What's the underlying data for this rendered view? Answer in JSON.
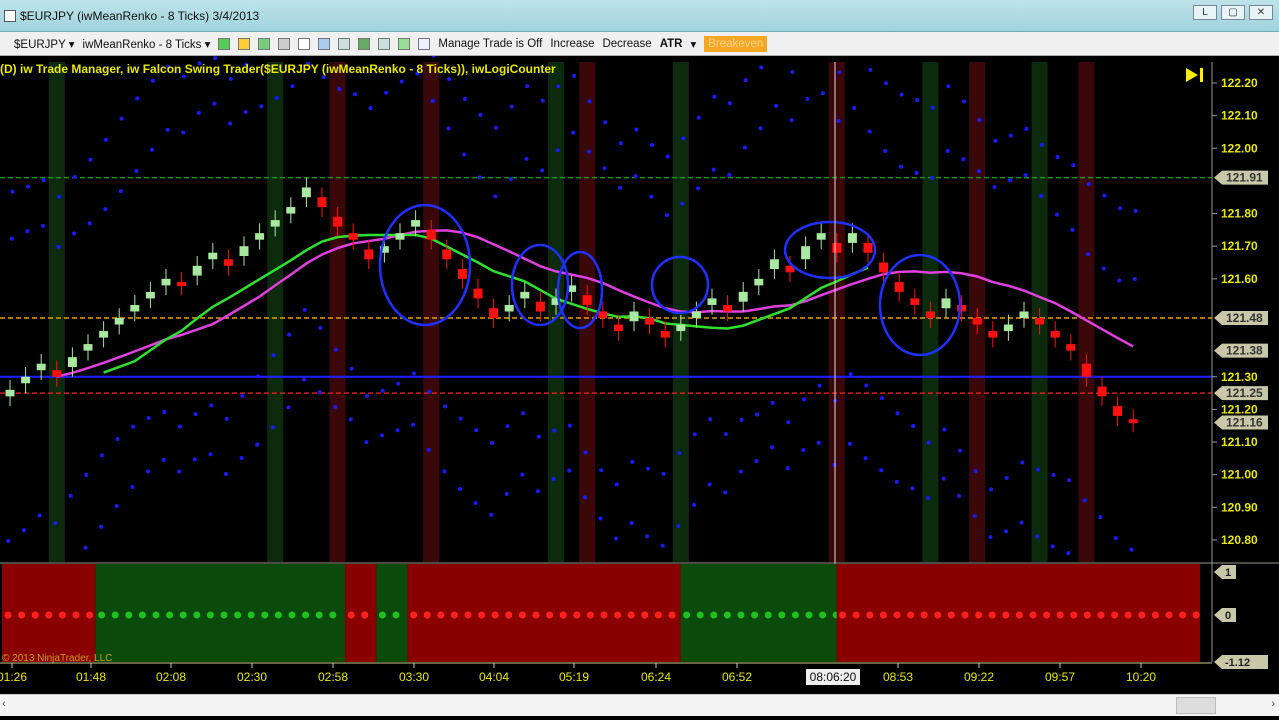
{
  "window": {
    "title": "$EURJPY (iwMeanRenko - 8 Ticks)  3/4/2013",
    "min": "L",
    "max": "▢",
    "close": "✕"
  },
  "toolbar": {
    "instrument": "$EURJPY ▾",
    "period": "iwMeanRenko - 8 Ticks ▾",
    "manage": "Manage Trade is Off",
    "increase": "Increase",
    "decrease": "Decrease",
    "atr": "ATR",
    "atr_arrow": "▾",
    "breakeven": "Breakeven"
  },
  "legend": "(D) iw Trade Manager, iw Falcon Swing Trader($EURJPY (iwMeanRenko - 8 Ticks)), iwLogiCounter",
  "copyright": "© 2013 NinjaTrader, LLC",
  "cursor_time": "08:06:20",
  "colors": {
    "up": "#a8e8a0",
    "down": "#ff1010",
    "ma_fast": "#e040e0",
    "ma_slow": "#30e030",
    "dots": "#1a1aff",
    "axis": "#e8e800"
  },
  "chart_data": {
    "type": "candlestick-renko",
    "ylim": [
      120.75,
      122.27
    ],
    "y_ticks": [
      "122.20",
      "122.10",
      "122.00",
      "121.80",
      "121.70",
      "121.60",
      "121.30",
      "121.20",
      "121.10",
      "121.00",
      "120.90",
      "120.80"
    ],
    "price_markers": [
      "121.91",
      "121.48",
      "121.38",
      "121.25",
      "121.16"
    ],
    "hlines": [
      {
        "price": 121.91,
        "color": "#1f8f1f",
        "dash": true
      },
      {
        "price": 121.48,
        "color": "#e0a000",
        "dash": true
      },
      {
        "price": 121.3,
        "color": "#2020ff",
        "dash": false
      },
      {
        "price": 121.25,
        "color": "#d02020",
        "dash": true
      }
    ],
    "closes": [
      121.26,
      121.3,
      121.34,
      121.3,
      121.36,
      121.4,
      121.44,
      121.48,
      121.52,
      121.56,
      121.6,
      121.58,
      121.64,
      121.68,
      121.64,
      121.7,
      121.74,
      121.78,
      121.82,
      121.88,
      121.82,
      121.76,
      121.72,
      121.66,
      121.7,
      121.74,
      121.78,
      121.72,
      121.66,
      121.6,
      121.54,
      121.48,
      121.52,
      121.56,
      121.5,
      121.54,
      121.58,
      121.52,
      121.48,
      121.44,
      121.5,
      121.46,
      121.42,
      121.46,
      121.5,
      121.54,
      121.5,
      121.56,
      121.6,
      121.66,
      121.62,
      121.7,
      121.74,
      121.68,
      121.74,
      121.68,
      121.62,
      121.56,
      121.52,
      121.48,
      121.54,
      121.5,
      121.46,
      121.42,
      121.46,
      121.5,
      121.46,
      121.42,
      121.38,
      121.3,
      121.24,
      121.18,
      121.16
    ],
    "highlight_bars": [
      {
        "index": 3,
        "color": "green"
      },
      {
        "index": 17,
        "color": "green"
      },
      {
        "index": 21,
        "color": "red"
      },
      {
        "index": 27,
        "color": "red"
      },
      {
        "index": 35,
        "color": "green"
      },
      {
        "index": 37,
        "color": "red"
      },
      {
        "index": 43,
        "color": "green"
      },
      {
        "index": 53,
        "color": "red"
      },
      {
        "index": 59,
        "color": "green"
      },
      {
        "index": 62,
        "color": "red"
      },
      {
        "index": 66,
        "color": "green"
      },
      {
        "index": 69,
        "color": "red"
      }
    ],
    "lower_pane": {
      "ticks": [
        "1",
        "0",
        "-1.12"
      ],
      "segments": [
        {
          "from": 0,
          "to": 6,
          "state": "red"
        },
        {
          "from": 6,
          "to": 22,
          "state": "green"
        },
        {
          "from": 22,
          "to": 24,
          "state": "red"
        },
        {
          "from": 24,
          "to": 26,
          "state": "green"
        },
        {
          "from": 26,
          "to": 43.5,
          "state": "red"
        },
        {
          "from": 43.5,
          "to": 53.5,
          "state": "green"
        },
        {
          "from": 53.5,
          "to": 77,
          "state": "red"
        }
      ]
    },
    "x_ticks": [
      "01:26",
      "01:48",
      "02:08",
      "02:30",
      "02:58",
      "03:30",
      "04:04",
      "05:19",
      "06:24",
      "06:52",
      "08:53",
      "09:22",
      "09:57",
      "10:20"
    ]
  }
}
